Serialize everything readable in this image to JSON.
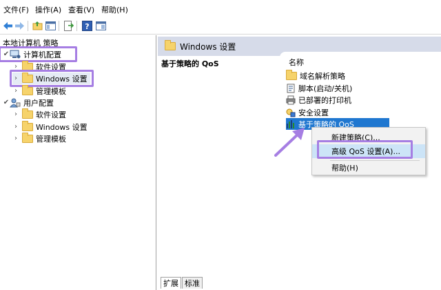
{
  "menubar": {
    "items": [
      {
        "label": "文件(F)"
      },
      {
        "label": "操作(A)"
      },
      {
        "label": "查看(V)"
      },
      {
        "label": "帮助(H)"
      }
    ]
  },
  "toolbar": {
    "buttons": [
      {
        "icon": "back-arrow-icon"
      },
      {
        "icon": "forward-arrow-icon"
      },
      {
        "icon": "up-folder-icon"
      },
      {
        "icon": "show-hide-tree-icon"
      },
      {
        "icon": "export-list-icon"
      },
      {
        "icon": "help-icon"
      },
      {
        "icon": "properties-pane-icon"
      }
    ]
  },
  "tree": {
    "root": "本地计算机 策略",
    "items": [
      {
        "label": "计算机配置",
        "level": 0,
        "expanded": true
      },
      {
        "label": "软件设置",
        "level": 1
      },
      {
        "label": "Windows 设置",
        "level": 1,
        "selected": true
      },
      {
        "label": "管理模板",
        "level": 1
      },
      {
        "label": "用户配置",
        "level": 0,
        "expanded": true
      },
      {
        "label": "软件设置",
        "level": 1
      },
      {
        "label": "Windows 设置",
        "level": 1
      },
      {
        "label": "管理模板",
        "level": 1
      }
    ]
  },
  "right": {
    "header_title": "Windows 设置",
    "section_label": "基于策略的 QoS",
    "column_header": "名称",
    "items": [
      {
        "label": "域名解析策略",
        "icon": "folder-icon"
      },
      {
        "label": "脚本(启动/关机)",
        "icon": "script-icon"
      },
      {
        "label": "已部署的打印机",
        "icon": "printer-icon"
      },
      {
        "label": "安全设置",
        "icon": "security-icon"
      },
      {
        "label": "基于策略的 QoS",
        "icon": "qos-chart-icon",
        "selected": true
      }
    ]
  },
  "context_menu": {
    "items": [
      {
        "label": "新建策略(C)..."
      },
      {
        "label": "高级 QoS 设置(A)...",
        "highlighted": true
      },
      {
        "label": "帮助(H)"
      }
    ]
  },
  "tabs": [
    {
      "label": "扩展",
      "active": true
    },
    {
      "label": "标准",
      "active": false
    }
  ],
  "colors": {
    "highlight_outline": "#a67ee3",
    "selection": "#1f77d0",
    "pane_header": "#d6dbe9",
    "context_hover": "#cce4f7"
  }
}
